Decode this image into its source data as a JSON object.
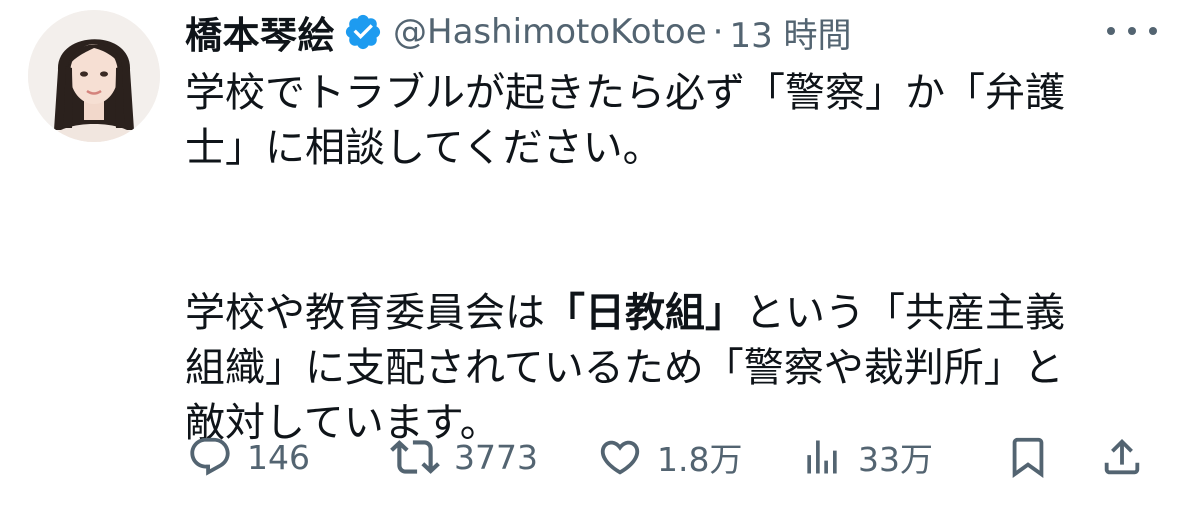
{
  "author": {
    "display_name": "橋本琴絵",
    "handle": "@HashimotoKotoe",
    "separator": "·",
    "time": "13 時間"
  },
  "tweet": {
    "para1_line1": "学校でトラブルが起きたら必ず「警察」か「弁護",
    "para1_line2": "士」に相談してください。",
    "para2_line1_a": "学校や教育委員会は",
    "para2_line1_bold": "「日教組」",
    "para2_line1_b": "という「共産主義",
    "para2_line2": "組織」に支配されているため「警察や裁判所」と",
    "para2_line3": "敵対しています。"
  },
  "actions": {
    "replies": "146",
    "retweets": "3773",
    "likes": "1.8万",
    "views": "33万"
  },
  "icons": {
    "verified": "verified-badge-icon",
    "more": "more-dots-icon",
    "reply": "reply-bubble-icon",
    "retweet": "retweet-icon",
    "like": "heart-icon",
    "views": "analytics-bars-icon",
    "bookmark": "bookmark-icon",
    "share": "share-upload-icon"
  },
  "colors": {
    "text": "#0f1419",
    "secondary": "#536471",
    "verified": "#1d9bf0"
  }
}
